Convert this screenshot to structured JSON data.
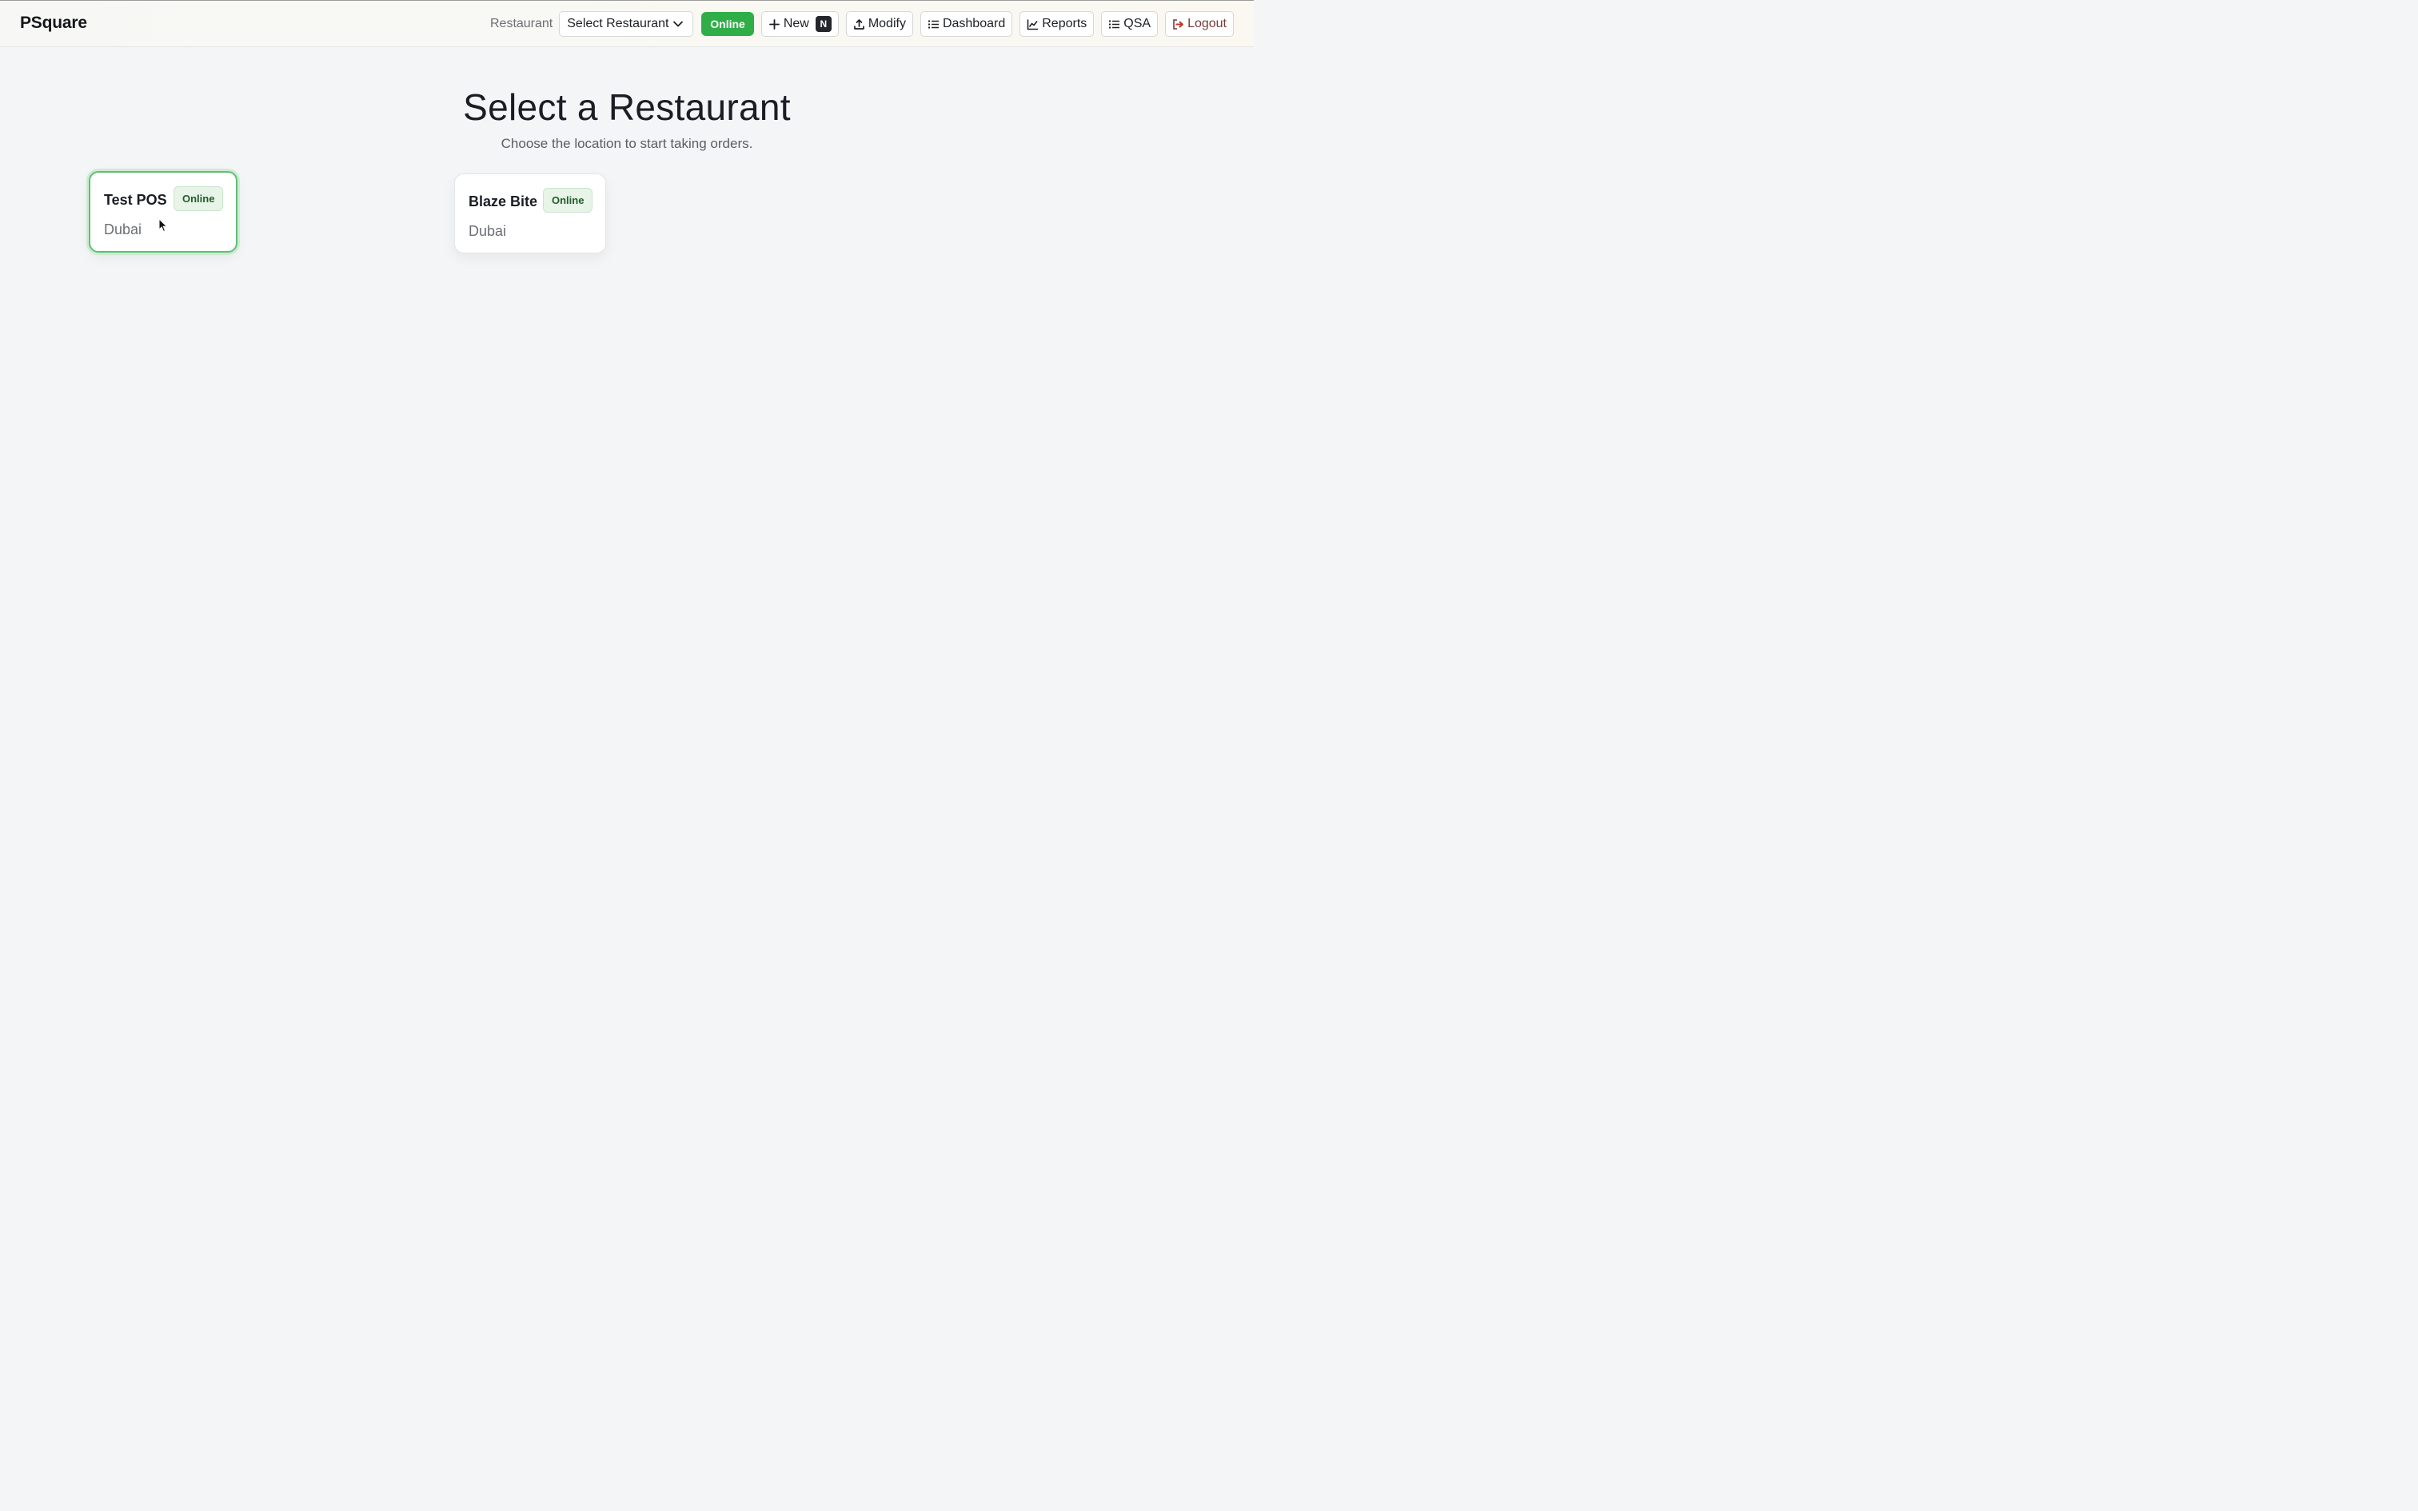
{
  "app": {
    "brand": "PSquare"
  },
  "header": {
    "restaurant_label": "Restaurant",
    "restaurant_select": {
      "selected": "Select Restaurant"
    },
    "status": "Online",
    "buttons": {
      "new": {
        "label": "New",
        "shortcut": "N",
        "icon": "plus-icon"
      },
      "modify": {
        "label": "Modify",
        "icon": "upload-icon"
      },
      "dashboard": {
        "label": "Dashboard",
        "icon": "list-icon"
      },
      "reports": {
        "label": "Reports",
        "icon": "line-chart-icon"
      },
      "qsa": {
        "label": "QSA",
        "icon": "list-icon"
      },
      "logout": {
        "label": "Logout",
        "icon": "logout-icon"
      }
    }
  },
  "main": {
    "title": "Select a Restaurant",
    "subtitle": "Choose the location to start taking orders.",
    "restaurants": [
      {
        "name": "Test POS",
        "status": "Online",
        "city": "Dubai",
        "selected": true
      },
      {
        "name": "Blaze Bite",
        "status": "Online",
        "city": "Dubai",
        "selected": false
      }
    ]
  },
  "colors": {
    "online_green": "#2fae47",
    "badge_bg": "#e7f4e7",
    "selected_border": "#5fbf72",
    "page_bg": "#f4f5f7"
  }
}
